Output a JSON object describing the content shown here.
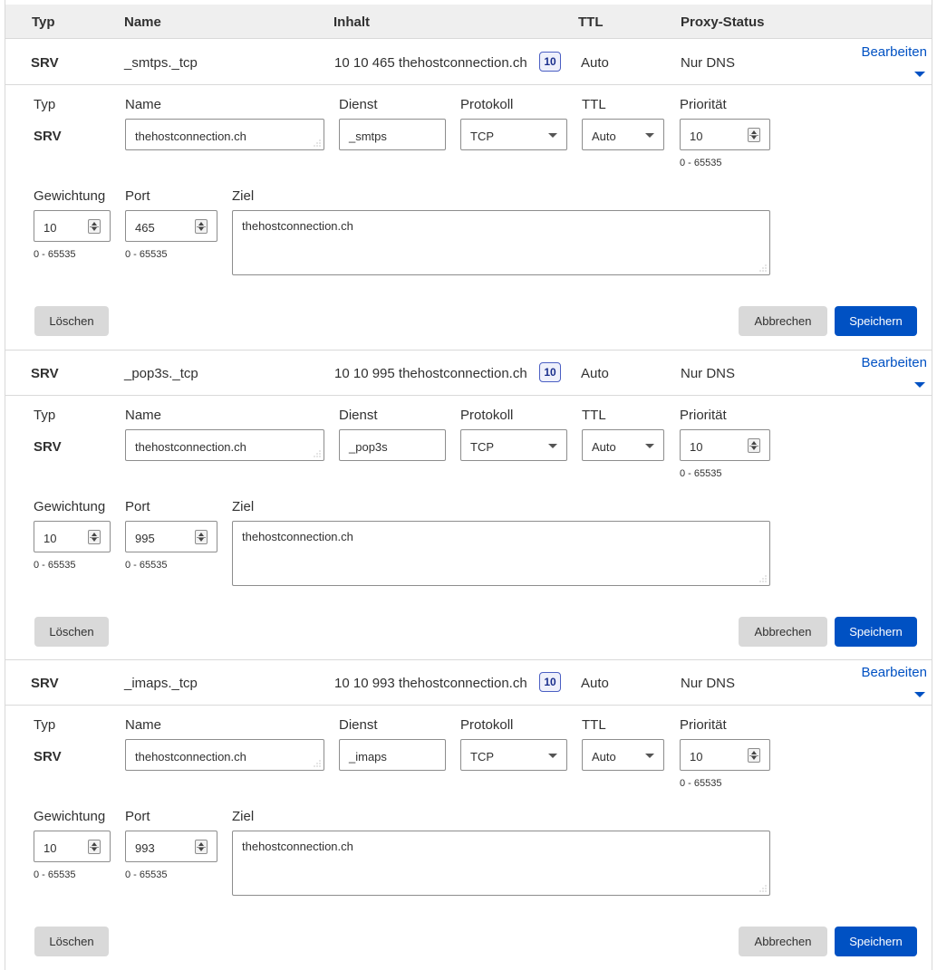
{
  "header": {
    "typ": "Typ",
    "name": "Name",
    "inhalt": "Inhalt",
    "ttl": "TTL",
    "proxy": "Proxy-Status"
  },
  "labels": {
    "typ": "Typ",
    "name": "Name",
    "dienst": "Dienst",
    "protokoll": "Protokoll",
    "ttl": "TTL",
    "prioritaet": "Priorität",
    "gewichtung": "Gewichtung",
    "port": "Port",
    "ziel": "Ziel",
    "range": "0 - 65535",
    "edit": "Bearbeiten",
    "delete": "Löschen",
    "cancel": "Abbrechen",
    "save": "Speichern"
  },
  "records": [
    {
      "type": "SRV",
      "name": "_smtps._tcp",
      "content": "10 10 465 thehostconnection.ch",
      "badge": "10",
      "ttl": "Auto",
      "proxy": "Nur DNS",
      "form": {
        "name": "thehostconnection.ch",
        "service": "_smtps",
        "protocol": "TCP",
        "ttl": "Auto",
        "priority": "10",
        "weight": "10",
        "port": "465",
        "target": "thehostconnection.ch"
      }
    },
    {
      "type": "SRV",
      "name": "_pop3s._tcp",
      "content": "10 10 995 thehostconnection.ch",
      "badge": "10",
      "ttl": "Auto",
      "proxy": "Nur DNS",
      "form": {
        "name": "thehostconnection.ch",
        "service": "_pop3s",
        "protocol": "TCP",
        "ttl": "Auto",
        "priority": "10",
        "weight": "10",
        "port": "995",
        "target": "thehostconnection.ch"
      }
    },
    {
      "type": "SRV",
      "name": "_imaps._tcp",
      "content": "10 10 993 thehostconnection.ch",
      "badge": "10",
      "ttl": "Auto",
      "proxy": "Nur DNS",
      "form": {
        "name": "thehostconnection.ch",
        "service": "_imaps",
        "protocol": "TCP",
        "ttl": "Auto",
        "priority": "10",
        "weight": "10",
        "port": "993",
        "target": "thehostconnection.ch"
      }
    }
  ],
  "colors": {
    "accent": "#0051c3",
    "badge_border": "#4b5fc3",
    "header_bg": "#efefef",
    "border": "#d9d9d9"
  }
}
